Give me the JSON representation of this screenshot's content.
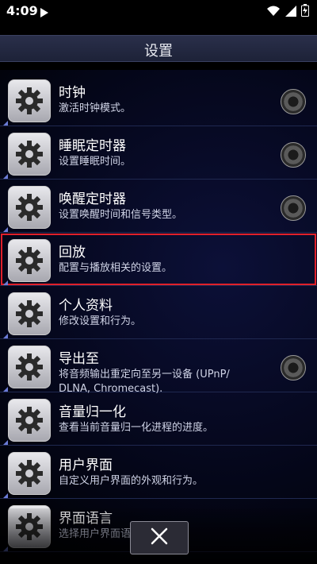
{
  "status_bar": {
    "time": "4:09",
    "icons": [
      "play-icon",
      "wifi-icon",
      "signal-icon",
      "battery-charging-icon"
    ]
  },
  "header": {
    "title": "设置"
  },
  "settings": [
    {
      "title": "时钟",
      "subtitle": "激活时钟模式。",
      "radio": true
    },
    {
      "title": "睡眠定时器",
      "subtitle": "设置睡眠时间。",
      "radio": true
    },
    {
      "title": "唤醒定时器",
      "subtitle": "设置唤醒时间和信号类型。",
      "radio": true
    },
    {
      "title": "回放",
      "subtitle": "配置与播放相关的设置。",
      "radio": false,
      "highlighted": true
    },
    {
      "title": "个人资料",
      "subtitle": "修改设置和行为。",
      "radio": false
    },
    {
      "title": "导出至",
      "subtitle": "将音频输出重定向至另一设备 (UPnP/ DLNA, Chromecast).",
      "radio": true
    },
    {
      "title": "音量归一化",
      "subtitle": "查看当前音量归一化进程的进度。",
      "radio": false
    },
    {
      "title": "用户界面",
      "subtitle": "自定义用户界面的外观和行为。",
      "radio": false
    },
    {
      "title": "界面语言",
      "subtitle": "选择用户界面语言。",
      "radio": false
    }
  ],
  "colors": {
    "accent_highlight": "#e0202a",
    "header_bg": "#1d2238"
  }
}
